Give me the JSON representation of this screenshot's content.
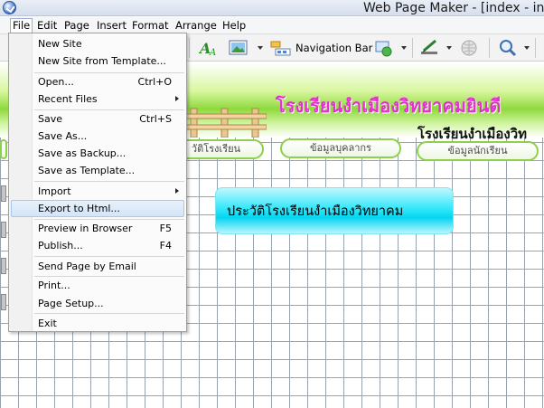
{
  "window": {
    "title": "Web Page Maker - [index - ind"
  },
  "menubar": {
    "items": [
      {
        "label": "File",
        "active": true
      },
      {
        "label": "Edit"
      },
      {
        "label": "Page"
      },
      {
        "label": "Insert"
      },
      {
        "label": "Format"
      },
      {
        "label": "Arrange"
      },
      {
        "label": "Help"
      }
    ]
  },
  "toolbar": {
    "navigation_bar_label": "Navigation Bar",
    "icons": [
      "text-icon",
      "image-icon",
      "navigation-bar-icon",
      "shape-icon",
      "pen-icon",
      "preview-globe-icon",
      "zoom-icon"
    ]
  },
  "file_menu": {
    "items": [
      {
        "label": "New Site",
        "shortcut": ""
      },
      {
        "label": "New Site from Template...",
        "shortcut": ""
      },
      {
        "label": "Open...",
        "shortcut": "Ctrl+O"
      },
      {
        "label": "Recent Files",
        "shortcut": "",
        "submenu": true
      },
      {
        "label": "Save",
        "shortcut": "Ctrl+S"
      },
      {
        "label": "Save As...",
        "shortcut": ""
      },
      {
        "label": "Save as Backup...",
        "shortcut": ""
      },
      {
        "label": "Save as Template...",
        "shortcut": ""
      },
      {
        "label": "Import",
        "shortcut": "",
        "submenu": true
      },
      {
        "label": "Export to Html...",
        "shortcut": "",
        "highlighted": true
      },
      {
        "label": "Preview in Browser",
        "shortcut": "F5"
      },
      {
        "label": "Publish...",
        "shortcut": "F4"
      },
      {
        "label": "Send Page by Email",
        "shortcut": ""
      },
      {
        "label": "Print...",
        "shortcut": ""
      },
      {
        "label": "Page Setup...",
        "shortcut": ""
      },
      {
        "label": "Exit",
        "shortcut": ""
      }
    ]
  },
  "page": {
    "banner_title": "โรงเรียนงำเมืองวิทยาคมยินดี",
    "banner_subtitle": "โรงเรียนงำเมืองวิท",
    "nav_buttons": [
      "วัติโรงเรียน",
      "ข้อมูลบุคลากร",
      "ข้อมูลนักเรียน"
    ],
    "history_heading": "ประวัติโรงเรียนงำเมืองวิทยาคม"
  },
  "colors": {
    "banner_title": "#e52fd0",
    "nav_border": "#8cd04b",
    "history_box": "#06d5ef",
    "menu_highlight": "#d3e5f8"
  }
}
